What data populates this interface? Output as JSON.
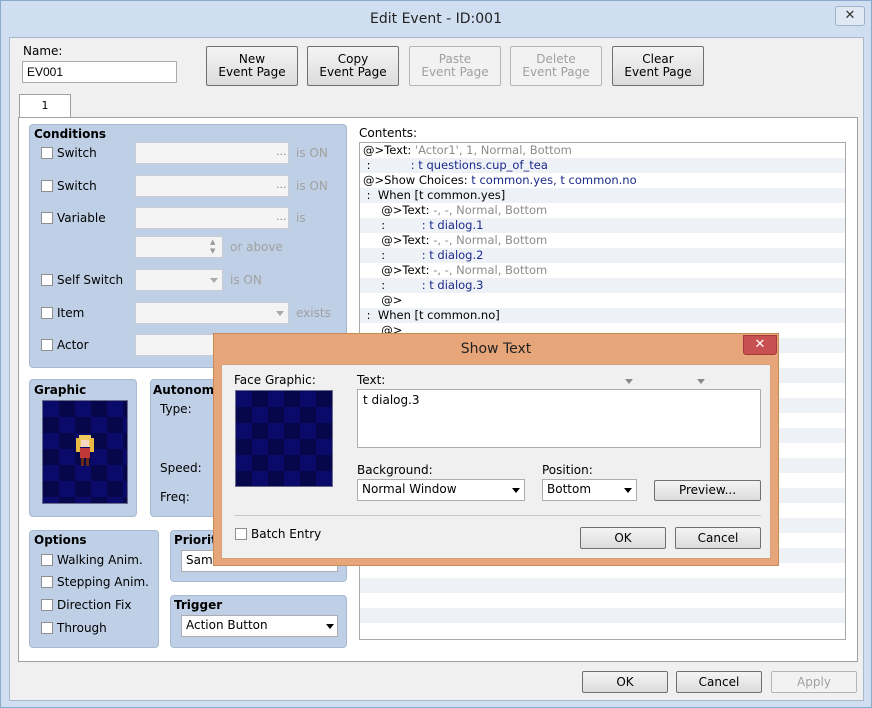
{
  "window": {
    "title": "Edit Event - ID:001",
    "close_glyph": "✕"
  },
  "name": {
    "label": "Name:",
    "value": "EV001"
  },
  "toolbar": {
    "new_page": "New\nEvent Page",
    "copy_page": "Copy\nEvent Page",
    "paste_page": "Paste\nEvent Page",
    "delete_page": "Delete\nEvent Page",
    "clear_page": "Clear\nEvent Page"
  },
  "tabs": [
    {
      "label": "1"
    }
  ],
  "conditions": {
    "title": "Conditions",
    "switch1": {
      "label": "Switch",
      "suffix": "is ON"
    },
    "switch2": {
      "label": "Switch",
      "suffix": "is ON"
    },
    "variable": {
      "label": "Variable",
      "suffix": "is",
      "suffix2": "or above"
    },
    "self_switch": {
      "label": "Self Switch",
      "suffix": "is ON"
    },
    "item": {
      "label": "Item",
      "suffix": "exists"
    },
    "actor": {
      "label": "Actor"
    },
    "ellipsis": "..."
  },
  "graphic": {
    "title": "Graphic"
  },
  "autonomous": {
    "title": "Autonomo",
    "type": "Type:",
    "speed": "Speed:",
    "freq": "Freq:"
  },
  "options": {
    "title": "Options",
    "items": [
      "Walking Anim.",
      "Stepping Anim.",
      "Direction Fix",
      "Through"
    ]
  },
  "priority": {
    "title": "Priorit",
    "value": "Same"
  },
  "trigger": {
    "title": "Trigger",
    "value": "Action Button"
  },
  "contents": {
    "label": "Contents:",
    "rows": [
      {
        "a": "@>Text: ",
        "b": "'Actor1', 1, Normal, Bottom",
        "bc": "gray2"
      },
      {
        "a": " :           ",
        "b": ": t questions.cup_of_tea",
        "bc": "navy"
      },
      {
        "a": "@>Show Choices: ",
        "b": "t common.yes, t common.no",
        "bc": "navy"
      },
      {
        "a": " :  When [t common.yes]",
        "b": "",
        "bc": ""
      },
      {
        "a": "     @>Text: ",
        "b": "-, -, Normal, Bottom",
        "bc": "gray2"
      },
      {
        "a": "     :          ",
        "b": ": t dialog.1",
        "bc": "navy"
      },
      {
        "a": "     @>Text: ",
        "b": "-, -, Normal, Bottom",
        "bc": "gray2"
      },
      {
        "a": "     :          ",
        "b": ": t dialog.2",
        "bc": "navy"
      },
      {
        "a": "     @>Text: ",
        "b": "-, -, Normal, Bottom",
        "bc": "gray2"
      },
      {
        "a": "     :          ",
        "b": ": t dialog.3",
        "bc": "navy"
      },
      {
        "a": "     @>",
        "b": "",
        "bc": ""
      },
      {
        "a": " :  When [t common.no]",
        "b": "",
        "bc": ""
      },
      {
        "a": "     @>",
        "b": "",
        "bc": ""
      }
    ]
  },
  "footer": {
    "ok": "OK",
    "cancel": "Cancel",
    "apply": "Apply"
  },
  "dialog": {
    "title": "Show Text",
    "close_glyph": "✕",
    "face_label": "Face Graphic:",
    "text_label": "Text:",
    "text_value": "t dialog.3",
    "background_label": "Background:",
    "background_value": "Normal Window",
    "position_label": "Position:",
    "position_value": "Bottom",
    "preview": "Preview...",
    "batch_entry": "Batch Entry",
    "ok": "OK",
    "cancel": "Cancel"
  }
}
